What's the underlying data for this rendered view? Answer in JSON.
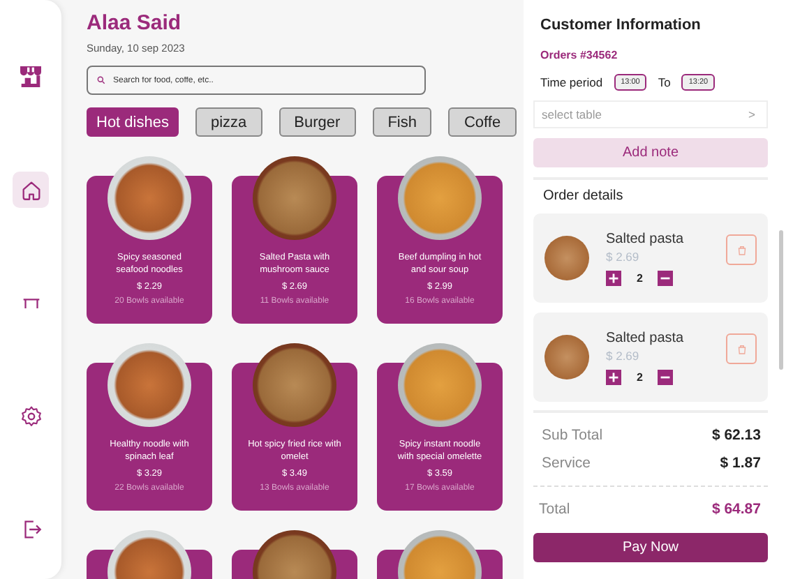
{
  "sidebar": {
    "logo": {
      "kind": "store"
    },
    "nav": [
      {
        "kind": "home",
        "selected": true
      },
      {
        "kind": "table",
        "selected": false
      },
      {
        "kind": "settings",
        "selected": false
      },
      {
        "kind": "logout",
        "selected": false
      }
    ]
  },
  "header": {
    "name": "Alaa Said",
    "date": "Sunday, 10 sep 2023"
  },
  "search": {
    "placeholder": "Search for food, coffe, etc.."
  },
  "categories": [
    {
      "label": "Hot dishes",
      "selected": true
    },
    {
      "label": "pizza",
      "selected": false
    },
    {
      "label": "Burger",
      "selected": false
    },
    {
      "label": "Fish",
      "selected": false
    },
    {
      "label": "Coffe",
      "selected": false
    }
  ],
  "dishes": [
    {
      "kind": "full",
      "name": "Spicy seasoned seafood noodles",
      "price": "$ 2.29",
      "stock": "20 Bowls available"
    },
    {
      "kind": "full",
      "name": "Salted Pasta with mushroom sauce",
      "price": "$ 2.69",
      "stock": "11 Bowls available"
    },
    {
      "kind": "full",
      "name": "Beef dumpling in hot and sour soup",
      "price": "$ 2.99",
      "stock": "16 Bowls available"
    },
    {
      "kind": "full",
      "name": "Healthy noodle with spinach leaf",
      "price": "$ 3.29",
      "stock": "22 Bowls available"
    },
    {
      "kind": "full",
      "name": "Hot spicy fried rice with omelet",
      "price": "$ 3.49",
      "stock": "13 Bowls available"
    },
    {
      "kind": "full",
      "name": "Spicy instant noodle with special omelette",
      "price": "$ 3.59",
      "stock": "17 Bowls available"
    },
    {
      "kind": "cut"
    },
    {
      "kind": "cut"
    },
    {
      "kind": "cut"
    }
  ],
  "customer": {
    "title": "Customer Information",
    "order_no": "Orders #34562",
    "time_label": "Time period",
    "from": "13:00",
    "to_label": "To",
    "to": "13:20",
    "table_placeholder": "select table",
    "table_arrow": ">",
    "add_note": "Add note"
  },
  "order": {
    "title": "Order details",
    "items": [
      {
        "name": "Salted pasta",
        "price": "$ 2.69",
        "qty": "2"
      },
      {
        "name": "Salted pasta",
        "price": "$ 2.69",
        "qty": "2"
      }
    ],
    "summary": [
      {
        "kind": "line",
        "label": "Sub Total",
        "value": "$ 62.13"
      },
      {
        "kind": "line",
        "label": "Service",
        "value": "$ 1.87"
      },
      {
        "kind": "total",
        "label": "Total",
        "value": "$ 64.87"
      }
    ],
    "pay": "Pay Now"
  }
}
